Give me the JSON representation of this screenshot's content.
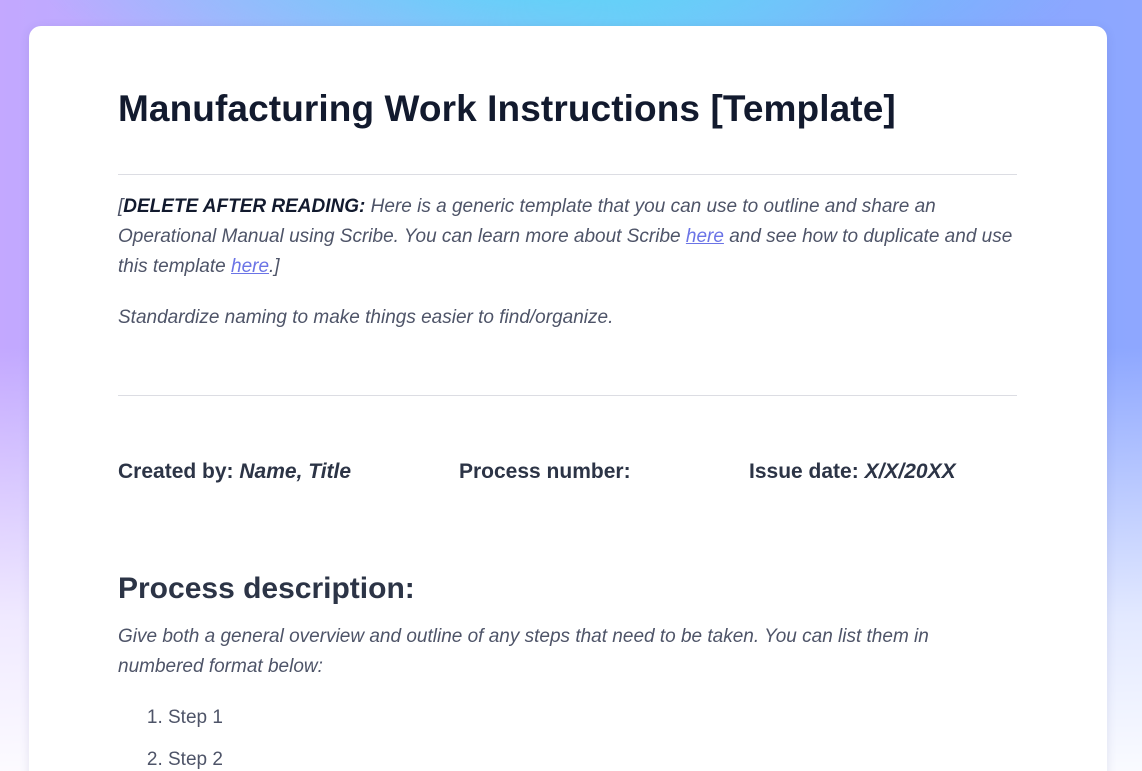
{
  "document": {
    "title": "Manufacturing Work Instructions [Template]",
    "note": {
      "open_bracket": "[",
      "bold_label": "DELETE AFTER READING:",
      "text_1": " Here is a generic template that you can use to outline and share an Operational Manual using Scribe. You can learn more about Scribe ",
      "link_1": "here",
      "text_2": " and see how to duplicate and use this template ",
      "link_2": "here",
      "close": ".]"
    },
    "hint": "Standardize naming to make things easier to find/organize.",
    "meta": {
      "created_by_label": "Created by:",
      "created_by_value": "Name, Title",
      "process_number_label": "Process number:",
      "issue_date_label": "Issue date:",
      "issue_date_value": "X/X/20XX"
    },
    "process_description": {
      "heading": "Process description:",
      "description": "Give both a general overview and outline of any steps that need to be taken. You can list them in numbered format below:",
      "steps": [
        "Step 1",
        "Step 2"
      ]
    }
  },
  "colors": {
    "link": "#6b74e6",
    "title": "#121a2e",
    "body_text": "#4e5468"
  }
}
